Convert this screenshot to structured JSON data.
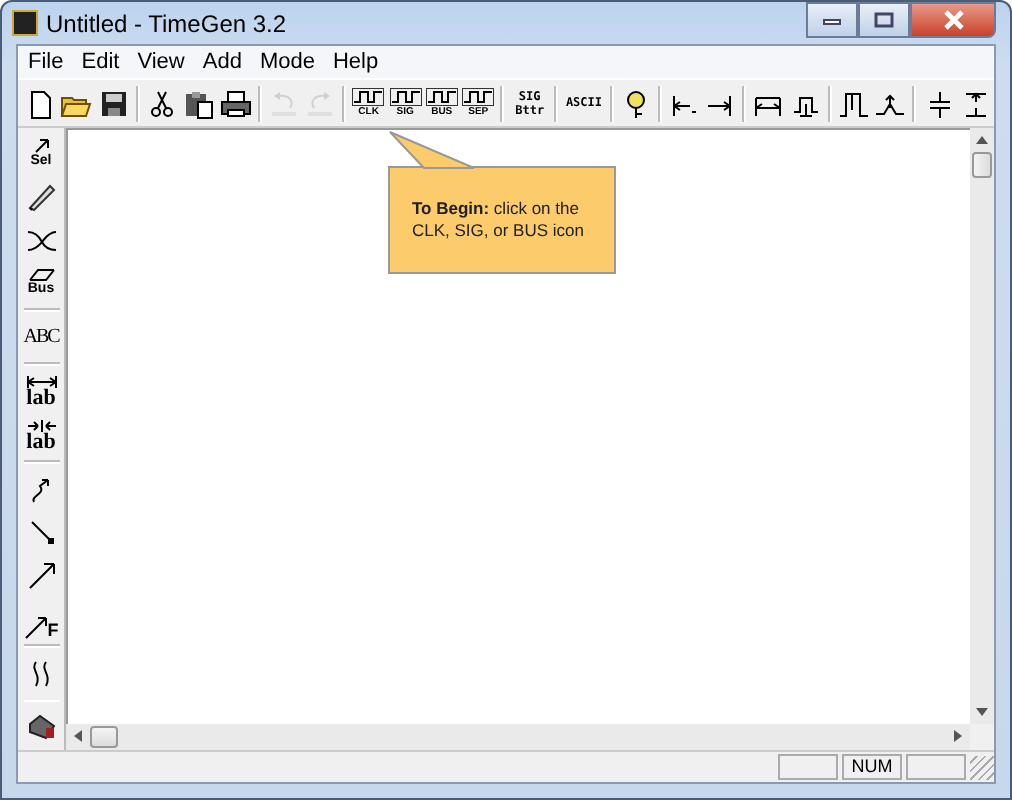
{
  "window": {
    "title": "Untitled - TimeGen 3.2"
  },
  "menu": [
    "File",
    "Edit",
    "View",
    "Add",
    "Mode",
    "Help"
  ],
  "toolbar": [
    [
      {
        "kind": "new",
        "disabled": false
      },
      {
        "kind": "open",
        "disabled": false
      },
      {
        "kind": "save",
        "disabled": false
      }
    ],
    [
      {
        "kind": "cut",
        "disabled": false
      },
      {
        "kind": "paste",
        "disabled": false
      },
      {
        "kind": "print",
        "disabled": false
      }
    ],
    [
      {
        "kind": "undo",
        "disabled": true
      },
      {
        "kind": "redo",
        "disabled": true
      }
    ],
    [
      {
        "kind": "signal",
        "label": "CLK",
        "disabled": false
      },
      {
        "kind": "signal",
        "label": "SIG",
        "disabled": false
      },
      {
        "kind": "signal",
        "label": "BUS",
        "disabled": false
      },
      {
        "kind": "signal",
        "label": "SEP",
        "disabled": false
      }
    ],
    [
      {
        "kind": "text",
        "label": "SIG Bttr",
        "disabled": false
      }
    ],
    [
      {
        "kind": "text",
        "label": "ASCII",
        "disabled": false
      }
    ],
    [
      {
        "kind": "help",
        "disabled": false
      }
    ],
    [
      {
        "kind": "delay-left",
        "disabled": false
      },
      {
        "kind": "delay-right",
        "disabled": false
      }
    ],
    [
      {
        "kind": "span",
        "disabled": false
      },
      {
        "kind": "span-pulse",
        "disabled": false
      }
    ],
    [
      {
        "kind": "pulse",
        "disabled": false
      },
      {
        "kind": "join",
        "disabled": false
      }
    ],
    [
      {
        "kind": "gap",
        "disabled": false
      },
      {
        "kind": "gap-inverse",
        "disabled": false
      }
    ]
  ],
  "left_toolbar": [
    [
      {
        "kind": "sel",
        "label": "Sel"
      },
      {
        "kind": "wire"
      },
      {
        "kind": "cross"
      },
      {
        "kind": "bus",
        "label": "Bus"
      }
    ],
    [
      {
        "kind": "abc",
        "label": "ABC"
      }
    ],
    [
      {
        "kind": "lab-out",
        "label": "lab"
      },
      {
        "kind": "lab-in",
        "label": "lab"
      }
    ],
    [
      {
        "kind": "curve"
      },
      {
        "kind": "line"
      },
      {
        "kind": "arrow"
      },
      {
        "kind": "arrow-f",
        "label": "F"
      }
    ],
    [
      {
        "kind": "squiggle"
      }
    ],
    [
      {
        "kind": "eraser"
      }
    ]
  ],
  "callout": {
    "text": "**To Begin:** click on the CLK, SIG, or BUS icon"
  },
  "status_bar": {
    "indicator": "NUM"
  }
}
